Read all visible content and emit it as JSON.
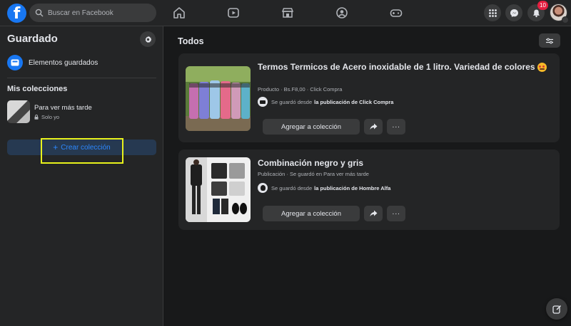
{
  "topbar": {
    "logo": "f",
    "search_placeholder": "Buscar en Facebook",
    "nav_icons": [
      "home-icon",
      "watch-icon",
      "marketplace-icon",
      "groups-icon",
      "gaming-icon"
    ],
    "notifications_badge": "10"
  },
  "sidebar": {
    "title": "Guardado",
    "saved_items_label": "Elementos guardados",
    "section_title": "Mis colecciones",
    "collections": [
      {
        "name": "Para ver más tarde",
        "privacy": "Solo yo"
      }
    ],
    "create_label": "Crear colección"
  },
  "main": {
    "title": "Todos",
    "items": [
      {
        "title": "Termos Termicos de Acero inoxidable de 1 litro. Variedad de colores",
        "meta": "Producto · Bs.F8,00 · Click Compra",
        "source_prefix": "Se guardó desde",
        "source_link": "la publicación de Click Compra",
        "add_label": "Agregar a colección",
        "more_label": "···"
      },
      {
        "title": "Combinación negro y gris",
        "meta": "Publicación · Se guardó en Para ver más tarde",
        "source_prefix": "Se guardó desde",
        "source_link": "la publicación de Hombre Alfa",
        "add_label": "Agregar a colección",
        "more_label": "···"
      }
    ]
  },
  "colors": {
    "accent": "#1877f2",
    "highlight": "#e8f21c",
    "background": "#18191a",
    "surface": "#242526"
  }
}
